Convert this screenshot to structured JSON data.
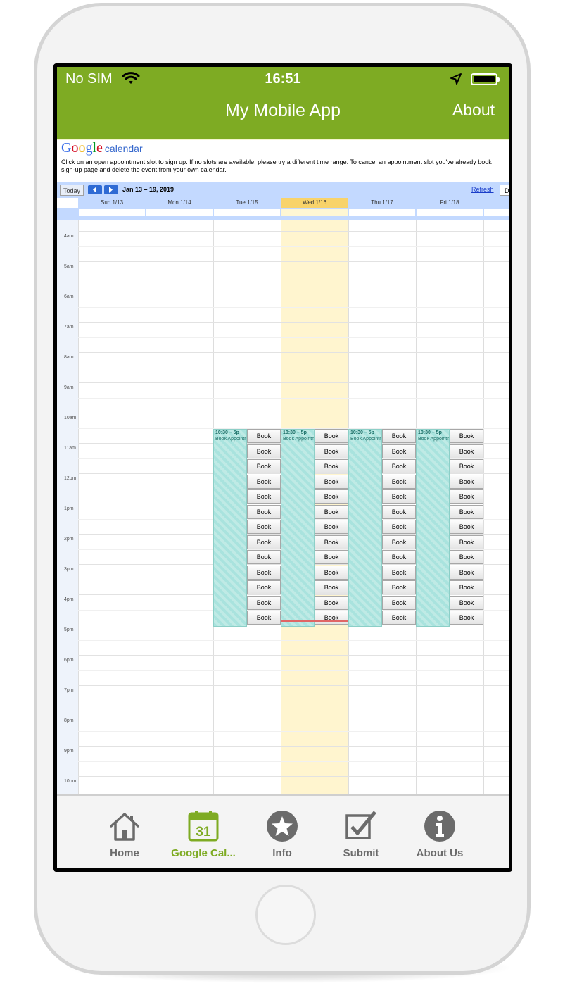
{
  "status": {
    "carrier": "No SIM",
    "time": "16:51"
  },
  "header": {
    "title": "My Mobile App",
    "about_label": "About"
  },
  "calendar": {
    "logo_text": "Google",
    "logo_sub": "calendar",
    "instructions_line1": "Click on an open appointment slot to sign up. If no slots are available, please try a different time range. To cancel an appointment slot you've already book",
    "instructions_line2": "sign-up page and delete the event from your own calendar.",
    "today_label": "Today",
    "range_label": "Jan 13 – 19, 2019",
    "refresh_label": "Refresh",
    "view_button": "D",
    "days": [
      "Sun 1/13",
      "Mon 1/14",
      "Tue 1/15",
      "Wed 1/16",
      "Thu 1/17",
      "Fri 1/18",
      "S"
    ],
    "today_index": 3,
    "hours": [
      "4am",
      "5am",
      "6am",
      "7am",
      "8am",
      "9am",
      "10am",
      "11am",
      "12pm",
      "1pm",
      "2pm",
      "3pm",
      "4pm",
      "5pm",
      "6pm",
      "7pm",
      "8pm",
      "9pm",
      "10pm"
    ],
    "slot": {
      "time": "10:30 – 5p",
      "label": "Book Appointment"
    },
    "slot_day_indexes": [
      2,
      3,
      4,
      5
    ],
    "book_label": "Book",
    "book_count": 13
  },
  "tabs": [
    {
      "label": "Home",
      "icon": "home-icon"
    },
    {
      "label": "Google Cal...",
      "icon": "calendar-icon",
      "active": true,
      "icon_text": "31"
    },
    {
      "label": "Info",
      "icon": "star-icon"
    },
    {
      "label": "Submit",
      "icon": "checkbox-icon"
    },
    {
      "label": "About Us",
      "icon": "info-icon"
    }
  ],
  "colors": {
    "accent": "#7eab23",
    "calendar_header": "#c3d9ff",
    "today_highlight": "#fff5cf",
    "slot": "#a9e3de"
  }
}
